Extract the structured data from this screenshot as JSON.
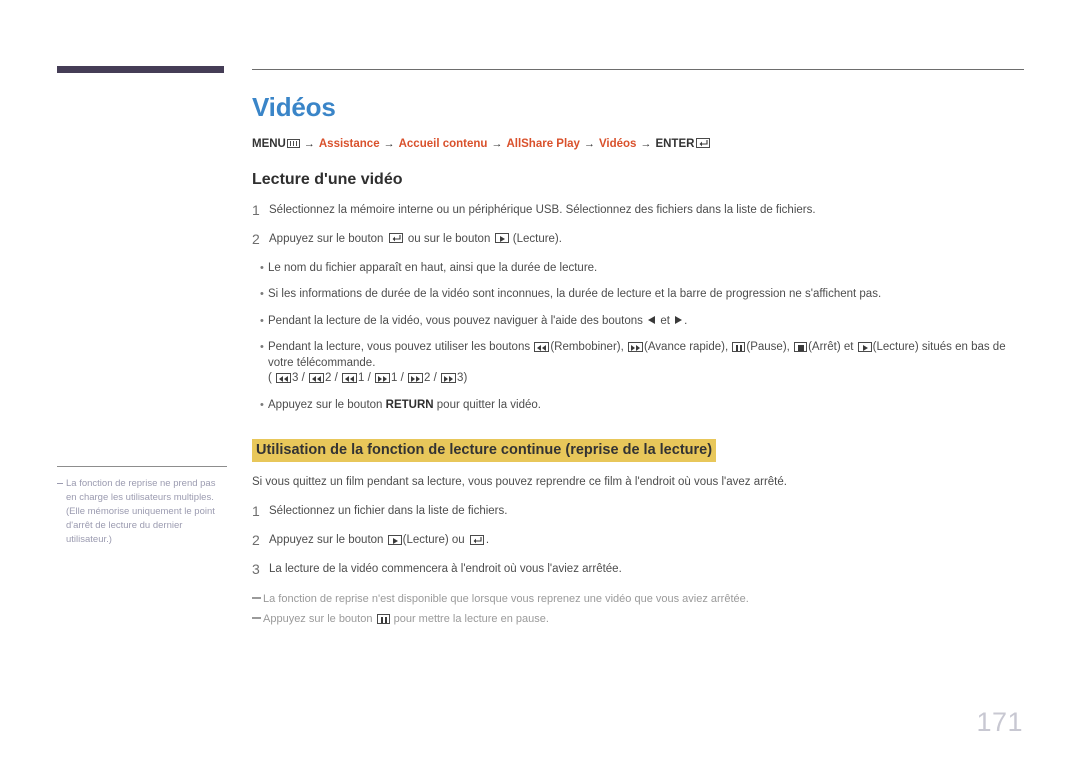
{
  "page": {
    "number": "171",
    "title": "Vidéos",
    "title_color": "#3a85c8",
    "accent_bar_color": "#453d56",
    "highlight_color": "#e8c75a",
    "link_color": "#d9512c"
  },
  "breadcrumb": {
    "menu_label": "MENU",
    "menu_icon": "menu-bars-icon",
    "enter_label": "ENTER",
    "enter_icon": "enter-key-icon",
    "arrow": "→",
    "items": [
      {
        "label": "Assistance"
      },
      {
        "label": "Accueil contenu"
      },
      {
        "label": "AllShare Play"
      },
      {
        "label": "Vidéos"
      }
    ]
  },
  "section_play": {
    "heading": "Lecture d'une vidéo",
    "steps": [
      {
        "number": "1",
        "text": "Sélectionnez la mémoire interne ou un périphérique USB. Sélectionnez des fichiers dans la liste de fichiers."
      },
      {
        "number": "2",
        "text_before": "Appuyez sur le bouton",
        "icon_1": "enter-key-icon",
        "text_middle": "ou sur le bouton",
        "icon_2": "play-button-icon",
        "text_after": "(Lecture)."
      }
    ],
    "bullets": [
      {
        "text": "Le nom du fichier apparaît en haut, ainsi que la durée de lecture."
      },
      {
        "text": "Si les informations de durée de la vidéo sont inconnues, la durée de lecture et la barre de progression ne s'affichent pas."
      },
      {
        "text_before": "Pendant la lecture de la vidéo, vous pouvez naviguer à l'aide des boutons",
        "icon_1": "arrow-left-icon",
        "text_middle": "et",
        "icon_2": "arrow-right-icon",
        "text_after": "."
      },
      {
        "text_before": "Pendant la lecture, vous pouvez utiliser les boutons",
        "label_rewind": "(Rembobiner),",
        "label_forward": "(Avance rapide),",
        "label_pause": "(Pause),",
        "label_stop": "(Arrêt) et",
        "label_play": "(Lecture) situés en bas de votre télécommande.",
        "speed_line": {
          "open": "(",
          "rew3": "3 /",
          "rew2": "2 /",
          "rew1": "1 /",
          "ff1": "1 /",
          "ff2": "2 /",
          "ff3": "3)"
        }
      },
      {
        "text_before": "Appuyez sur le bouton",
        "bold": "RETURN",
        "text_after": "pour quitter la vidéo."
      }
    ]
  },
  "section_resume": {
    "heading": "Utilisation de la fonction de lecture continue (reprise de la lecture)",
    "intro": "Si vous quittez un film pendant sa lecture, vous pouvez reprendre ce film à l'endroit où vous l'avez arrêté.",
    "steps": [
      {
        "number": "1",
        "text": "Sélectionnez un fichier dans la liste de fichiers."
      },
      {
        "number": "2",
        "text_before": "Appuyez sur le bouton",
        "icon_1": "play-button-icon",
        "text_middle": "(Lecture) ou",
        "icon_2": "enter-key-icon",
        "text_after": "."
      },
      {
        "number": "3",
        "text": "La lecture de la vidéo commencera à l'endroit où vous l'aviez arrêtée."
      }
    ],
    "footnotes": [
      {
        "text": "La fonction de reprise n'est disponible que lorsque vous reprenez une vidéo que vous aviez arrêtée."
      },
      {
        "text_before": "Appuyez sur le bouton",
        "icon": "pause-button-icon",
        "text_after": "pour mettre la lecture en pause."
      }
    ]
  },
  "side_note": {
    "text": "La fonction de reprise ne prend pas en charge les utilisateurs multiples. (Elle mémorise uniquement le point d'arrêt de lecture du dernier utilisateur.)"
  }
}
